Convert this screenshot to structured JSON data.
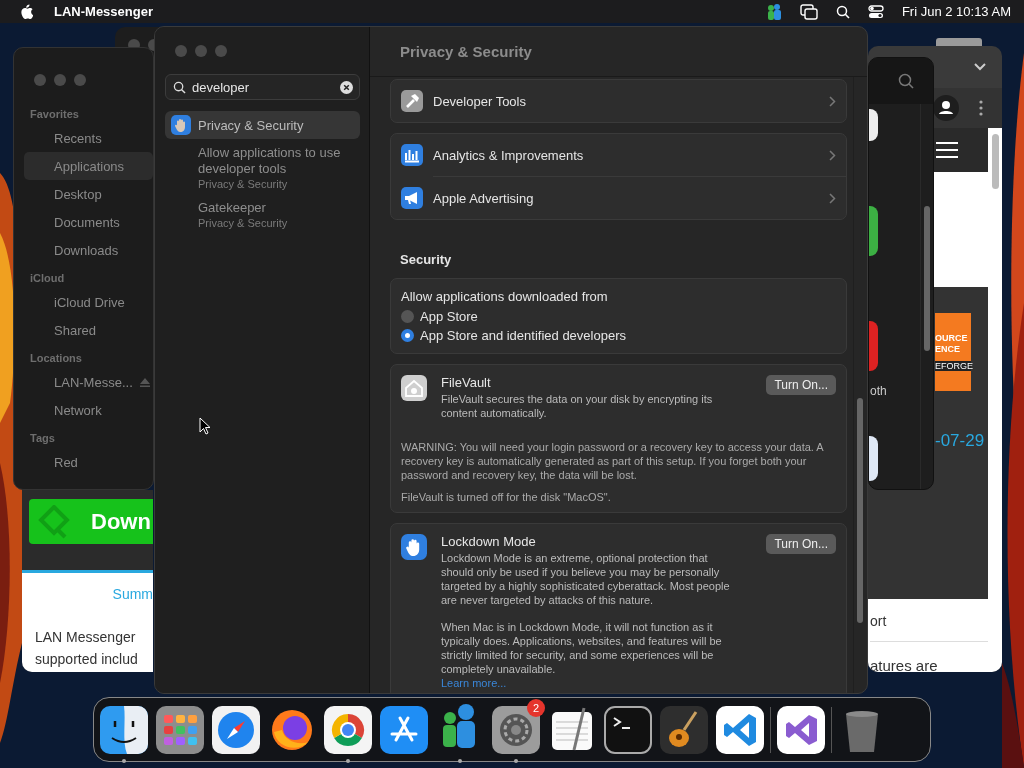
{
  "menu_bar": {
    "app_name": "LAN-Messenger",
    "clock": "Fri Jun 2  10:13 AM"
  },
  "finder": {
    "sections": [
      {
        "title": "Favorites",
        "items": [
          {
            "label": "Recents",
            "selected": false,
            "ejectable": false
          },
          {
            "label": "Applications",
            "selected": true,
            "ejectable": false
          },
          {
            "label": "Desktop",
            "selected": false,
            "ejectable": false
          },
          {
            "label": "Documents",
            "selected": false,
            "ejectable": false
          },
          {
            "label": "Downloads",
            "selected": false,
            "ejectable": false
          }
        ]
      },
      {
        "title": "iCloud",
        "items": [
          {
            "label": "iCloud Drive",
            "selected": false,
            "ejectable": false
          },
          {
            "label": "Shared",
            "selected": false,
            "ejectable": false
          }
        ]
      },
      {
        "title": "Locations",
        "items": [
          {
            "label": "LAN-Messe...",
            "selected": false,
            "ejectable": true
          },
          {
            "label": "Network",
            "selected": false,
            "ejectable": false
          }
        ]
      },
      {
        "title": "Tags",
        "items": [
          {
            "label": "Red",
            "selected": false,
            "ejectable": false
          }
        ]
      }
    ]
  },
  "browser": {
    "download_button": "Down",
    "left_tab": "Summ",
    "left_lines": [
      "LAN Messenger",
      "supported includ"
    ],
    "badge_lines": [
      "OURCE",
      "ENCE",
      "EFORGE"
    ],
    "date": "-07-29",
    "right_tab": "ort",
    "right_line": "atures are"
  },
  "back_window": {
    "label": "oth"
  },
  "settings": {
    "search": {
      "value": "developer"
    },
    "results": [
      {
        "title": "Privacy & Security",
        "kind": "pane",
        "selected": true
      },
      {
        "title": "Allow applications to use developer tools",
        "subtitle": "Privacy & Security",
        "kind": "match",
        "selected": false
      },
      {
        "title": "Gatekeeper",
        "subtitle": "Privacy & Security",
        "kind": "match",
        "selected": false
      }
    ],
    "title": "Privacy & Security",
    "groups": [
      {
        "rows": [
          {
            "label": "Developer Tools"
          }
        ]
      },
      {
        "rows": [
          {
            "label": "Analytics & Improvements"
          },
          {
            "label": "Apple Advertising"
          }
        ]
      }
    ],
    "security": {
      "heading": "Security",
      "allow_label": "Allow applications downloaded from",
      "options": [
        {
          "label": "App Store",
          "selected": false
        },
        {
          "label": "App Store and identified developers",
          "selected": true
        }
      ]
    },
    "filevault": {
      "title": "FileVault",
      "description": "FileVault secures the data on your disk by encrypting its content automatically.",
      "button": "Turn On...",
      "warning": "WARNING: You will need your login password or a recovery key to access your data. A recovery key is automatically generated as part of this setup. If you forget both your password and recovery key, the data will be lost.",
      "status": "FileVault is turned off for the disk \"MacOS\"."
    },
    "lockdown": {
      "title": "Lockdown Mode",
      "description": "Lockdown Mode is an extreme, optional protection that should only be used if you believe you may be personally targeted by a highly sophisticated cyberattack. Most people are never targeted by attacks of this nature.",
      "description_2": "When Mac is in Lockdown Mode, it will not function as it typically does. Applications, websites, and features will be strictly limited for security, and some experiences will be completely unavailable.",
      "button": "Turn On...",
      "link": "Learn more..."
    }
  },
  "dock": {
    "items": [
      {
        "kind": "app",
        "running": true
      },
      {
        "kind": "app",
        "running": false
      },
      {
        "kind": "app",
        "running": false
      },
      {
        "kind": "app",
        "running": false
      },
      {
        "kind": "app",
        "running": true
      },
      {
        "kind": "app",
        "running": false
      },
      {
        "kind": "app",
        "running": true
      },
      {
        "kind": "app",
        "running": true,
        "badge": "2"
      },
      {
        "kind": "app",
        "running": false
      },
      {
        "kind": "app",
        "running": false
      },
      {
        "kind": "app",
        "running": false
      },
      {
        "kind": "app",
        "running": false
      },
      {
        "kind": "separator"
      },
      {
        "kind": "app",
        "running": false
      },
      {
        "kind": "separator"
      },
      {
        "kind": "app",
        "running": false
      }
    ]
  }
}
